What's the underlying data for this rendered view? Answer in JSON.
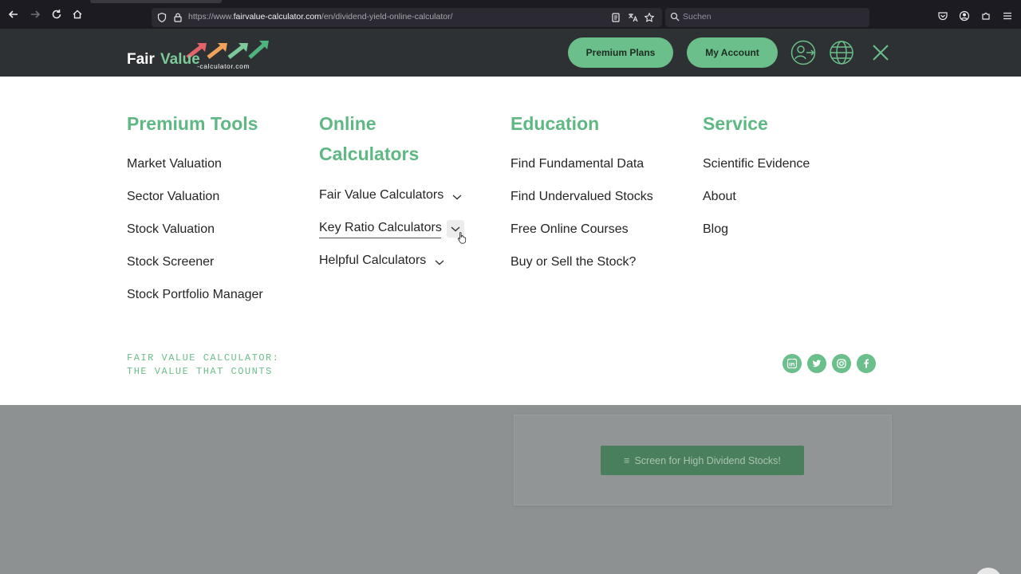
{
  "browser": {
    "url_prefix": "https://www.",
    "url_domain": "fairvalue-calculator.com",
    "url_path": "/en/dividend-yield-online-calculator/",
    "search_placeholder": "Suchen"
  },
  "header": {
    "logo_fair": "Fair",
    "logo_value": "Value",
    "logo_sub": "-calculator.com",
    "premium_label": "Premium Plans",
    "account_label": "My Account",
    "arrow_colors": [
      "#e2646a",
      "#f0a15a",
      "#7ec99a",
      "#4fb37d"
    ]
  },
  "menu": {
    "premium_tools": {
      "title": "Premium Tools",
      "items": [
        "Market Valuation",
        "Sector Valuation",
        "Stock Valuation",
        "Stock Screener",
        "Stock Portfolio Manager"
      ]
    },
    "online_calculators": {
      "title_line1": "Online",
      "title_line2": "Calculators",
      "items": [
        "Fair Value Calculators",
        "Key Ratio Calculators",
        "Helpful Calculators"
      ]
    },
    "education": {
      "title": "Education",
      "items": [
        "Find Fundamental Data",
        "Find Undervalued Stocks",
        "Free Online Courses",
        "Buy or Sell the Stock?"
      ]
    },
    "service": {
      "title": "Service",
      "items": [
        "Scientific Evidence",
        "About",
        "Blog"
      ]
    },
    "tagline_line1": "FAIR VALUE CALCULATOR:",
    "tagline_line2": "THE VALUE THAT COUNTS",
    "social": [
      "linkedin-icon",
      "twitter-icon",
      "instagram-icon",
      "facebook-icon"
    ]
  },
  "page": {
    "cta_label": "Screen for High Dividend Stocks!"
  },
  "colors": {
    "accent": "#6bbf8a",
    "header_bg": "#2d3133",
    "overlay_bg": "#8d9191"
  }
}
